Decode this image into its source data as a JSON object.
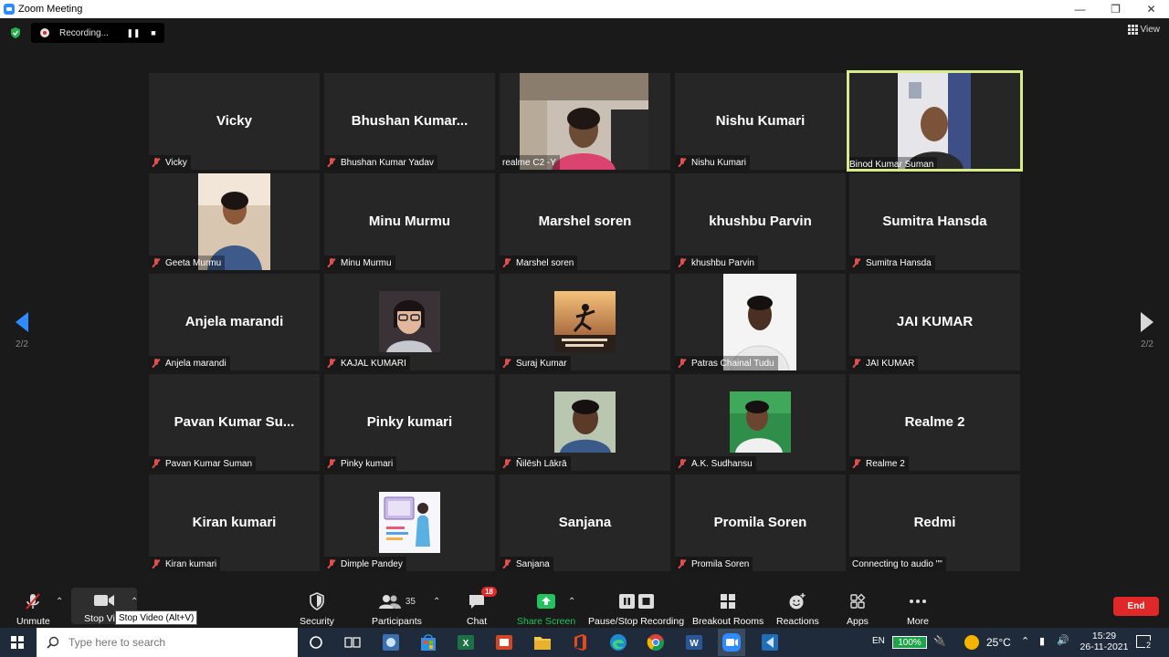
{
  "window": {
    "title": "Zoom Meeting"
  },
  "recording": {
    "status": "Recording...",
    "pause_icon": "pause-icon",
    "stop_icon": "stop-icon"
  },
  "view_button": {
    "label": "View"
  },
  "page_indicator": {
    "left": "2/2",
    "right": "2/2"
  },
  "tiles": [
    {
      "big": "Vicky",
      "label": "Vicky",
      "muted": true
    },
    {
      "big": "Bhushan  Kumar...",
      "label": "Bhushan Kumar Yadav",
      "muted": true
    },
    {
      "big": "",
      "label": "realme C2 -Y",
      "muted": false,
      "video": true
    },
    {
      "big": "Nishu Kumari",
      "label": "Nishu Kumari",
      "muted": true
    },
    {
      "big": "",
      "label": "Binod Kumar Suman",
      "muted": false,
      "video": true,
      "active": true
    },
    {
      "big": "",
      "label": "Geeta Murmu",
      "muted": true,
      "video": true
    },
    {
      "big": "Minu Murmu",
      "label": "Minu Murmu",
      "muted": true
    },
    {
      "big": "Marshel soren",
      "label": "Marshel soren",
      "muted": true
    },
    {
      "big": "khushbu Parvin",
      "label": "khushbu Parvin",
      "muted": true
    },
    {
      "big": "Sumitra Hansda",
      "label": "Sumitra Hansda",
      "muted": true
    },
    {
      "big": "Anjela marandi",
      "label": "Anjela marandi",
      "muted": true
    },
    {
      "big": "",
      "label": "KAJAL KUMARI",
      "muted": true,
      "video": true
    },
    {
      "big": "",
      "label": "Suraj Kumar",
      "muted": true,
      "video": true
    },
    {
      "big": "",
      "label": "Patras Chainal Tudu",
      "muted": true,
      "video": true
    },
    {
      "big": "JAI KUMAR",
      "label": "JAI KUMAR",
      "muted": true
    },
    {
      "big": "Pavan Kumar Su...",
      "label": "Pavan Kumar Suman",
      "muted": true
    },
    {
      "big": "Pinky kumari",
      "label": "Pinky kumari",
      "muted": true
    },
    {
      "big": "",
      "label": "Ñilēsh Lākrā",
      "muted": true,
      "video": true
    },
    {
      "big": "",
      "label": "A.K. Sudhansu",
      "muted": true,
      "video": true
    },
    {
      "big": "Realme 2",
      "label": "Realme 2",
      "muted": true
    },
    {
      "big": "Kiran kumari",
      "label": "Kiran kumari",
      "muted": true
    },
    {
      "big": "",
      "label": "Dimple Pandey",
      "muted": true,
      "video": true
    },
    {
      "big": "Sanjana",
      "label": "Sanjana",
      "muted": true
    },
    {
      "big": "Promila Soren",
      "label": "Promila Soren",
      "muted": true
    },
    {
      "big": "Redmi",
      "label": "Connecting to audio \"\"",
      "muted": false
    }
  ],
  "toolbar": {
    "unmute": "Unmute",
    "stop_video": "Stop Vi",
    "security": "Security",
    "participants": "Participants",
    "participants_count": "35",
    "chat": "Chat",
    "chat_badge": "18",
    "share_screen": "Share Screen",
    "pause_stop_recording": "Pause/Stop Recording",
    "breakout_rooms": "Breakout Rooms",
    "reactions": "Reactions",
    "apps": "Apps",
    "more": "More",
    "end": "End",
    "tooltip": "Stop Video (Alt+V)"
  },
  "taskbar": {
    "search_placeholder": "Type here to search",
    "language": "EN",
    "battery": "100%",
    "temperature": "25°C",
    "time": "15:29",
    "date": "26-11-2021",
    "notification_count": "2"
  },
  "colors": {
    "accent": "#2d8cff",
    "end": "#e02828",
    "active_border": "#d7ec86",
    "share_green": "#22c35e"
  }
}
